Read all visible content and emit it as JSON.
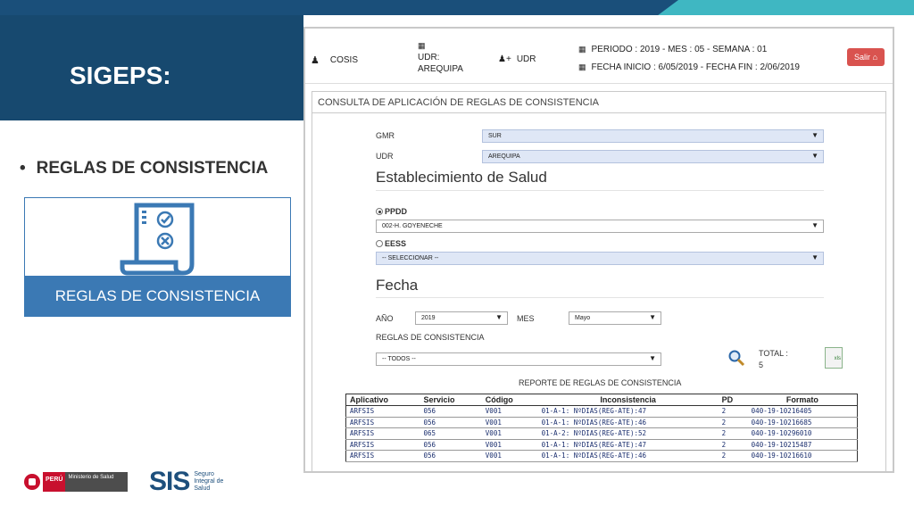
{
  "slide": {
    "title": "SIGEPS:",
    "bullet": "REGLAS DE CONSISTENCIA",
    "card_label": "REGLAS DE CONSISTENCIA"
  },
  "topbar": {
    "user": "COSIS",
    "udr_label": "UDR:",
    "udr_value": "AREQUIPA",
    "role": "UDR",
    "periodo": "PERIODO : 2019 - MES : 05 - SEMANA : 01",
    "fechas": "FECHA INICIO : 6/05/2019 - FECHA FIN : 2/06/2019",
    "salir": "Salir"
  },
  "form": {
    "header": "CONSULTA DE APLICACIÓN DE REGLAS DE CONSISTENCIA",
    "gmr_label": "GMR",
    "gmr_value": "SUR",
    "udr_label": "UDR",
    "udr_value": "AREQUIPA",
    "section_establecimiento": "Establecimiento de Salud",
    "ppdd_label": "PPDD",
    "ppdd_value": "002-H. GOYENECHE",
    "eess_label": "EESS",
    "eess_value": "-- SELECCIONAR --",
    "section_fecha": "Fecha",
    "anio_label": "AÑO",
    "anio_value": "2019",
    "mes_label": "MES",
    "mes_value": "Mayo",
    "reglas_label": "REGLAS DE CONSISTENCIA",
    "reglas_value": "-- TODOS --",
    "total_label": "TOTAL :",
    "total_value": "5",
    "xls_label": "xls"
  },
  "report": {
    "title": "REPORTE DE REGLAS DE CONSISTENCIA",
    "columns": [
      "Aplicativo",
      "Servicio",
      "Código",
      "Inconsistencia",
      "PD",
      "Formato"
    ],
    "rows": [
      [
        "ARFSIS",
        "056",
        "V001",
        "01-A-1: NºDIAS(REG-ATE):47",
        "2",
        "040-19-10216405"
      ],
      [
        "ARFSIS",
        "056",
        "V001",
        "01-A-1: NºDIAS(REG-ATE):46",
        "2",
        "040-19-10216685"
      ],
      [
        "ARFSIS",
        "065",
        "V001",
        "01-A-2: NºDIAS(REG-ATE):52",
        "2",
        "040-19-10296010"
      ],
      [
        "ARFSIS",
        "056",
        "V001",
        "01-A-1: NºDIAS(REG-ATE):47",
        "2",
        "040-19-10215487"
      ],
      [
        "ARFSIS",
        "056",
        "V001",
        "01-A-1: NºDIAS(REG-ATE):46",
        "2",
        "040-19-10216610"
      ]
    ]
  },
  "footer": {
    "peru": "PERÚ",
    "ministerio": "Ministerio de Salud",
    "sis": "SIS",
    "sis_sub": "Seguro Integral de Salud"
  },
  "colors": {
    "dark_blue": "#17496f",
    "teal": "#3fb7c2",
    "card_blue": "#3b79b4",
    "salir_red": "#d9534f"
  }
}
